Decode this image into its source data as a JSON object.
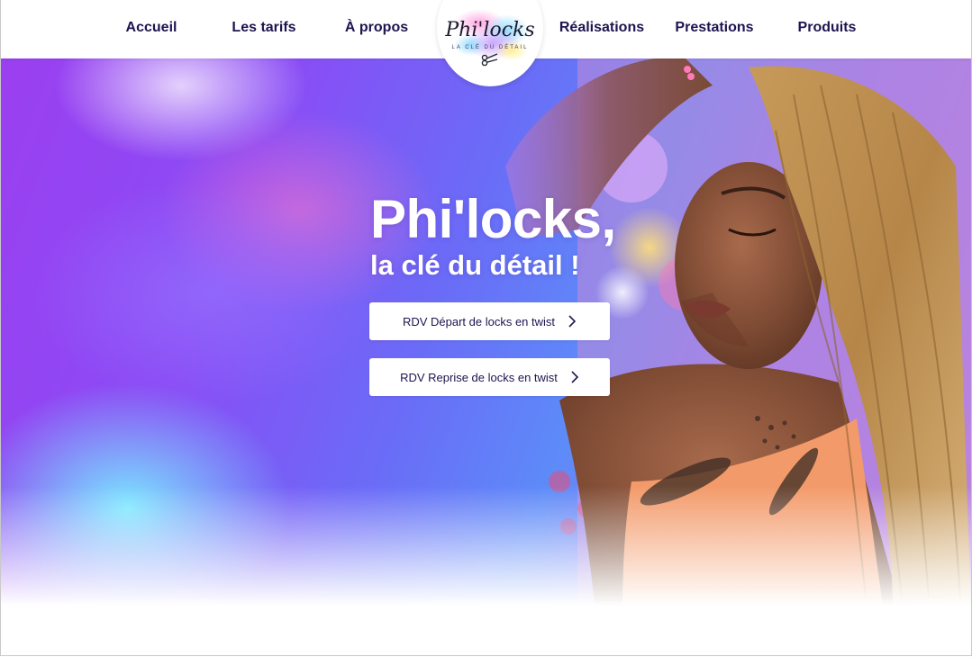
{
  "nav": {
    "items": [
      {
        "label": "Accueil"
      },
      {
        "label": "Les tarifs"
      },
      {
        "label": "À propos"
      },
      {
        "label": "Réalisations"
      },
      {
        "label": "Prestations"
      },
      {
        "label": "Produits"
      }
    ]
  },
  "logo": {
    "name": "Phi'locks",
    "tagline": "LA CLÉ DU DÉTAIL"
  },
  "hero": {
    "title": "Phi'locks,",
    "subtitle": "la clé du détail !",
    "buttons": [
      {
        "label": "RDV Départ de locks en twist",
        "icon": "chevron-right-icon"
      },
      {
        "label": "RDV Reprise de locks en twist",
        "icon": "chevron-right-icon"
      }
    ]
  },
  "colors": {
    "nav_text": "#1d1550",
    "hero_text": "#ffffff",
    "button_bg": "#ffffff",
    "accent_purple": "#9b3ff0",
    "accent_cyan": "#78f0ff"
  }
}
